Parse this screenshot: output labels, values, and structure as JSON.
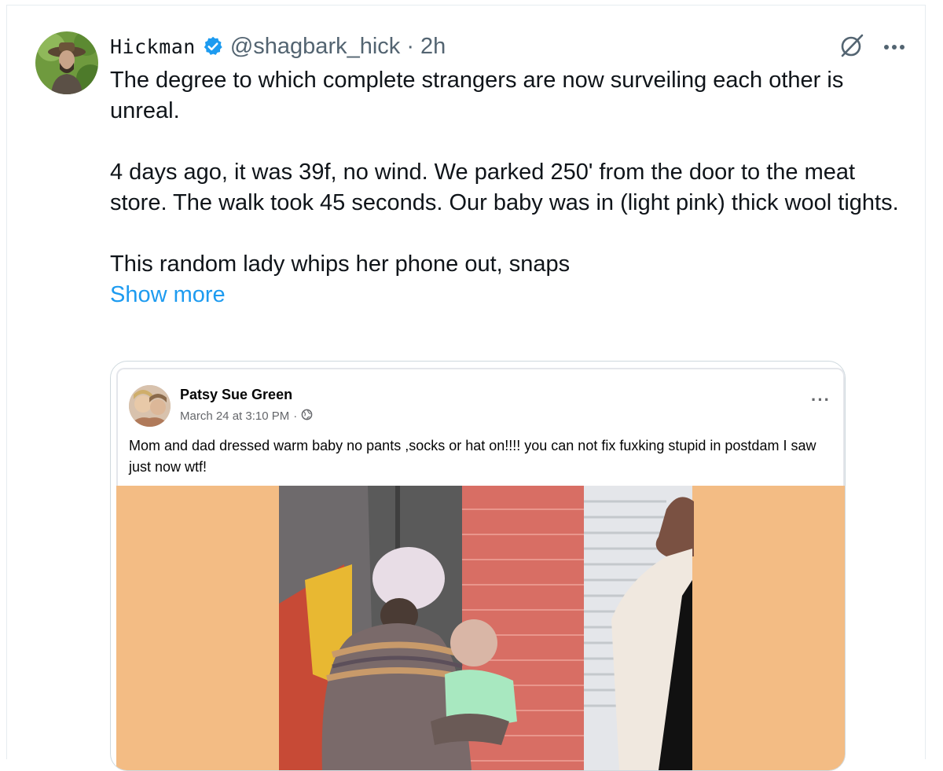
{
  "tweet": {
    "display_name": "Hickman",
    "handle": "@shagbark_hick",
    "separator": "·",
    "time": "2h",
    "paragraphs": [
      "The degree to which complete strangers are now surveiling each other is unreal.",
      "4 days ago, it was 39f, no wind. We parked 250' from the door to the meat store. The walk took 45 seconds. Our baby was in (light pink) thick wool tights.",
      "This random lady whips her phone out, snaps"
    ],
    "show_more": "Show more",
    "accent_color": "#1d9bf0",
    "icons": [
      "verified-badge-icon",
      "grok-icon",
      "more-options-icon"
    ]
  },
  "embedded_post": {
    "author": "Patsy Sue Green",
    "timestamp": "March 24 at 3:10 PM",
    "meta_separator": "·",
    "post_text": "Mom and dad dressed warm baby no pants ,socks or hat on!!!! you can not fix fuxking stupid in postdam I saw just now wtf!",
    "more_label": "···",
    "icons": [
      "globe-icon",
      "more-options-icon"
    ],
    "photo_background_color": "#f3bc84"
  }
}
